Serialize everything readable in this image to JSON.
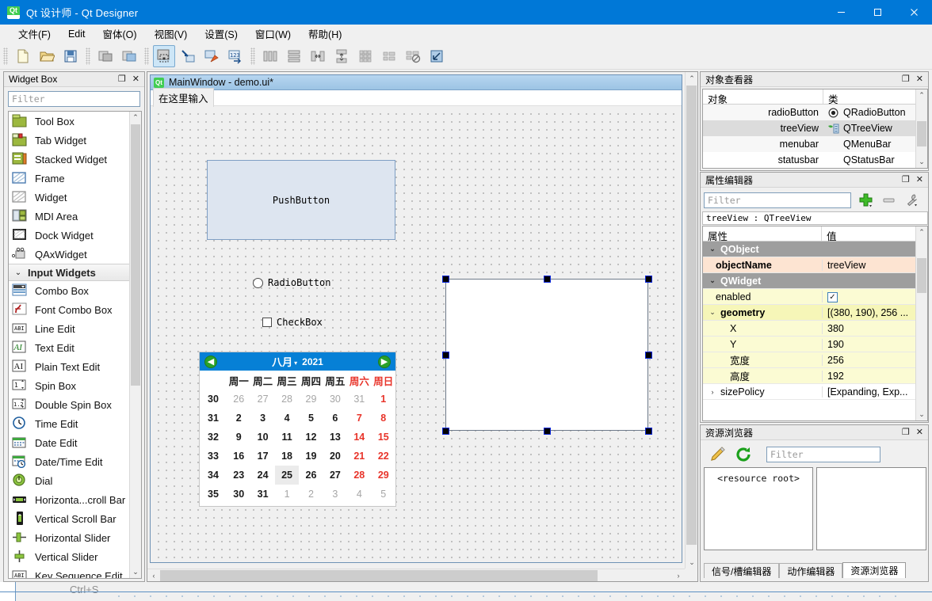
{
  "window": {
    "title": "Qt 设计师 - Qt Designer",
    "logo_icon": "qt-logo-icon",
    "minimize_label": "—",
    "maximize_label": "▢",
    "close_label": "✕"
  },
  "menubar": {
    "items": [
      {
        "label": "文件(F)",
        "name": "menu-file"
      },
      {
        "label": "Edit",
        "name": "menu-edit"
      },
      {
        "label": "窗体(O)",
        "name": "menu-form"
      },
      {
        "label": "视图(V)",
        "name": "menu-view"
      },
      {
        "label": "设置(S)",
        "name": "menu-settings"
      },
      {
        "label": "窗口(W)",
        "name": "menu-window"
      },
      {
        "label": "帮助(H)",
        "name": "menu-help"
      }
    ]
  },
  "toolbar": {
    "groups": [
      {
        "buttons": [
          {
            "name": "new-form-button",
            "icon": "new-document-icon",
            "active": false
          },
          {
            "name": "open-form-button",
            "icon": "open-folder-icon",
            "active": false
          },
          {
            "name": "save-form-button",
            "icon": "save-disk-icon",
            "active": false
          }
        ]
      },
      {
        "buttons": [
          {
            "name": "undo-button",
            "icon": "undo-icon",
            "active": false
          },
          {
            "name": "redo-button",
            "icon": "redo-icon",
            "active": false
          }
        ]
      },
      {
        "buttons": [
          {
            "name": "edit-widgets-button",
            "icon": "edit-widgets-icon",
            "active": true
          },
          {
            "name": "edit-signals-slots-button",
            "icon": "signals-slots-icon",
            "active": false
          },
          {
            "name": "edit-buddies-button",
            "icon": "buddies-icon",
            "active": false
          },
          {
            "name": "edit-tab-order-button",
            "icon": "tab-order-icon",
            "active": false
          }
        ]
      },
      {
        "buttons": [
          {
            "name": "layout-horizontally-button",
            "icon": "layout-horizontal-icon",
            "active": false
          },
          {
            "name": "layout-vertically-button",
            "icon": "layout-vertical-icon",
            "active": false
          },
          {
            "name": "layout-splitter-horizontal-button",
            "icon": "splitter-horizontal-icon",
            "active": false
          },
          {
            "name": "layout-splitter-vertical-button",
            "icon": "splitter-vertical-icon",
            "active": false
          },
          {
            "name": "layout-grid-button",
            "icon": "layout-grid-icon",
            "active": false
          },
          {
            "name": "layout-form-button",
            "icon": "layout-form-icon",
            "active": false
          },
          {
            "name": "break-layout-button",
            "icon": "break-layout-icon",
            "active": false
          },
          {
            "name": "adjust-size-button",
            "icon": "adjust-size-icon",
            "active": false
          }
        ]
      }
    ]
  },
  "widget_box": {
    "title": "Widget Box",
    "float_label": "❐",
    "close_label": "✕",
    "filter_placeholder": "Filter",
    "scroll_up": "⌃",
    "scroll_down": "⌄",
    "items": [
      {
        "type": "item",
        "label": "Tool Box",
        "icon": "tool-box-icon"
      },
      {
        "type": "item",
        "label": "Tab Widget",
        "icon": "tab-widget-icon"
      },
      {
        "type": "item",
        "label": "Stacked Widget",
        "icon": "stacked-widget-icon"
      },
      {
        "type": "item",
        "label": "Frame",
        "icon": "frame-icon"
      },
      {
        "type": "item",
        "label": "Widget",
        "icon": "widget-icon"
      },
      {
        "type": "item",
        "label": "MDI Area",
        "icon": "mdi-area-icon"
      },
      {
        "type": "item",
        "label": "Dock Widget",
        "icon": "dock-widget-icon"
      },
      {
        "type": "item",
        "label": "QAxWidget",
        "icon": "qax-widget-icon"
      },
      {
        "type": "section",
        "label": "Input Widgets",
        "icon": "chevron-down-icon"
      },
      {
        "type": "item",
        "label": "Combo Box",
        "icon": "combo-box-icon"
      },
      {
        "type": "item",
        "label": "Font Combo Box",
        "icon": "font-combo-box-icon"
      },
      {
        "type": "item",
        "label": "Line Edit",
        "icon": "line-edit-icon"
      },
      {
        "type": "item",
        "label": "Text Edit",
        "icon": "text-edit-icon"
      },
      {
        "type": "item",
        "label": "Plain Text Edit",
        "icon": "plain-text-edit-icon"
      },
      {
        "type": "item",
        "label": "Spin Box",
        "icon": "spin-box-icon"
      },
      {
        "type": "item",
        "label": "Double Spin Box",
        "icon": "double-spin-box-icon"
      },
      {
        "type": "item",
        "label": "Time Edit",
        "icon": "time-edit-icon"
      },
      {
        "type": "item",
        "label": "Date Edit",
        "icon": "date-edit-icon"
      },
      {
        "type": "item",
        "label": "Date/Time Edit",
        "icon": "date-time-edit-icon"
      },
      {
        "type": "item",
        "label": "Dial",
        "icon": "dial-icon"
      },
      {
        "type": "item",
        "label": "Horizonta...croll Bar",
        "icon": "horizontal-scroll-bar-icon"
      },
      {
        "type": "item",
        "label": "Vertical Scroll Bar",
        "icon": "vertical-scroll-bar-icon"
      },
      {
        "type": "item",
        "label": "Horizontal Slider",
        "icon": "horizontal-slider-icon"
      },
      {
        "type": "item",
        "label": "Vertical Slider",
        "icon": "vertical-slider-icon"
      },
      {
        "type": "item",
        "label": "Key Sequence Edit",
        "icon": "key-sequence-edit-icon"
      }
    ]
  },
  "form_window": {
    "title": "MainWindow - demo.ui*",
    "logo_icon": "qt-logo-icon",
    "menubar_placeholder": "在这里输入",
    "widgets": {
      "push_button": {
        "label": "PushButton",
        "name": "pushButton"
      },
      "radio_button": {
        "label": "RadioButton",
        "name": "radioButton"
      },
      "check_box": {
        "label": "CheckBox",
        "name": "checkBox"
      },
      "tree_view": {
        "name": "treeView"
      }
    },
    "calendar": {
      "month": "八月",
      "year": "2021",
      "caret": "▾",
      "prev_label": "◀",
      "next_label": "▶",
      "week_header": "",
      "day_headers": [
        "周一",
        "周二",
        "周三",
        "周四",
        "周五",
        "周六",
        "周日"
      ],
      "weekend_columns": [
        5,
        6
      ],
      "weeks": [
        {
          "num": "30",
          "days": [
            {
              "d": "26",
              "other": true
            },
            {
              "d": "27",
              "other": true
            },
            {
              "d": "28",
              "other": true
            },
            {
              "d": "29",
              "other": true
            },
            {
              "d": "30",
              "other": true
            },
            {
              "d": "31",
              "other": true
            },
            {
              "d": "1",
              "other": false
            }
          ]
        },
        {
          "num": "31",
          "days": [
            {
              "d": "2"
            },
            {
              "d": "3"
            },
            {
              "d": "4"
            },
            {
              "d": "5"
            },
            {
              "d": "6"
            },
            {
              "d": "7"
            },
            {
              "d": "8"
            }
          ]
        },
        {
          "num": "32",
          "days": [
            {
              "d": "9"
            },
            {
              "d": "10"
            },
            {
              "d": "11"
            },
            {
              "d": "12"
            },
            {
              "d": "13"
            },
            {
              "d": "14"
            },
            {
              "d": "15"
            }
          ]
        },
        {
          "num": "33",
          "days": [
            {
              "d": "16"
            },
            {
              "d": "17"
            },
            {
              "d": "18"
            },
            {
              "d": "19"
            },
            {
              "d": "20"
            },
            {
              "d": "21"
            },
            {
              "d": "22"
            }
          ]
        },
        {
          "num": "34",
          "days": [
            {
              "d": "23"
            },
            {
              "d": "24"
            },
            {
              "d": "25",
              "today": true
            },
            {
              "d": "26"
            },
            {
              "d": "27"
            },
            {
              "d": "28"
            },
            {
              "d": "29"
            }
          ]
        },
        {
          "num": "35",
          "days": [
            {
              "d": "30"
            },
            {
              "d": "31"
            },
            {
              "d": "1",
              "other": true
            },
            {
              "d": "2",
              "other": true
            },
            {
              "d": "3",
              "other": true
            },
            {
              "d": "4",
              "other": true
            },
            {
              "d": "5",
              "other": true
            }
          ]
        }
      ]
    }
  },
  "object_inspector": {
    "title": "对象查看器",
    "float_label": "❐",
    "close_label": "✕",
    "columns": [
      "对象",
      "类"
    ],
    "scroll_up": "⌃",
    "scroll_down": "⌄",
    "rows": [
      {
        "object": "radioButton",
        "class": "QRadioButton",
        "icon": "radio-button-icon",
        "selected": false
      },
      {
        "object": "treeView",
        "class": "QTreeView",
        "icon": "tree-view-icon",
        "selected": true
      },
      {
        "object": "menubar",
        "class": "QMenuBar",
        "icon": "",
        "selected": false
      },
      {
        "object": "statusbar",
        "class": "QStatusBar",
        "icon": "",
        "selected": false
      }
    ]
  },
  "property_editor": {
    "title": "属性编辑器",
    "float_label": "❐",
    "close_label": "✕",
    "filter_placeholder": "Filter",
    "add_icon": "plus-icon",
    "remove_icon": "minus-icon",
    "configure_icon": "wrench-icon",
    "object_line": "treeView : QTreeView",
    "columns": [
      "属性",
      "值"
    ],
    "scroll_up": "⌃",
    "scroll_down": "⌄",
    "rows": [
      {
        "style": "group",
        "chev": "⌄",
        "indent": 0,
        "name": "QObject",
        "value": ""
      },
      {
        "style": "objname",
        "chev": "",
        "indent": 1,
        "name": "objectName",
        "value": "treeView"
      },
      {
        "style": "group",
        "chev": "⌄",
        "indent": 0,
        "name": "QWidget",
        "value": ""
      },
      {
        "style": "yellow",
        "chev": "",
        "indent": 1,
        "name": "enabled",
        "value": "",
        "checkbox": true
      },
      {
        "style": "yellow-strong",
        "chev": "⌄",
        "indent": 0,
        "name": "geometry",
        "value": "[(380, 190), 256 ...",
        "bold": true
      },
      {
        "style": "yellow",
        "chev": "",
        "indent": 2,
        "name": "X",
        "value": "380"
      },
      {
        "style": "yellow",
        "chev": "",
        "indent": 2,
        "name": "Y",
        "value": "190"
      },
      {
        "style": "yellow",
        "chev": "",
        "indent": 2,
        "name": "宽度",
        "value": "256"
      },
      {
        "style": "yellow",
        "chev": "",
        "indent": 2,
        "name": "高度",
        "value": "192"
      },
      {
        "style": "plain",
        "chev": "›",
        "indent": 0,
        "name": "sizePolicy",
        "value": "[Expanding, Exp..."
      }
    ]
  },
  "resource_browser": {
    "title": "资源浏览器",
    "float_label": "❐",
    "close_label": "✕",
    "edit_icon": "pencil-icon",
    "reload_icon": "reload-icon",
    "filter_placeholder": "Filter",
    "root_label": "<resource root>",
    "tabs": [
      {
        "label": "信号/槽编辑器",
        "active": false
      },
      {
        "label": "动作编辑器",
        "active": false
      },
      {
        "label": "资源浏览器",
        "active": true
      }
    ]
  },
  "statusbar": {
    "shortcut_hint": "Ctrl+S"
  },
  "colors": {
    "accent": "#0078d7",
    "calendar_header": "#0680d6",
    "weekend_red": "#e8342a",
    "selection_handle": "#0a28dc",
    "property_group": "#9e9e9e",
    "objectname_row": "#fde4d2",
    "geometry_row": "#f6f6b8"
  }
}
